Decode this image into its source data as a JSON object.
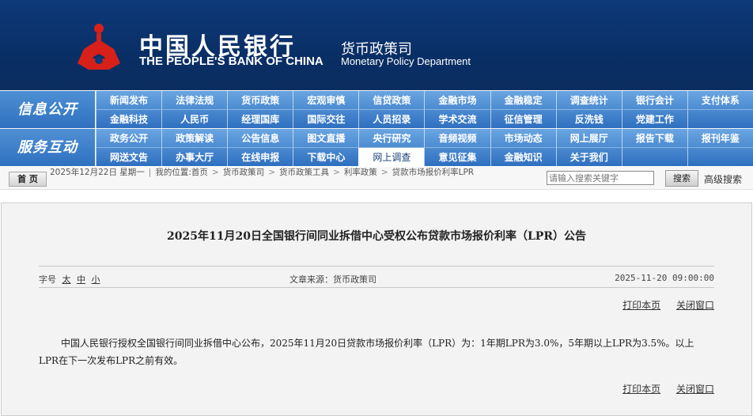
{
  "header": {
    "logo_cn": "中国人民银行",
    "logo_en": "THE PEOPLE'S BANK OF CHINA",
    "dept_cn": "货币政策司",
    "dept_en": "Monetary Policy Department",
    "emblem_color": "#d7201a"
  },
  "nav": {
    "info_label": "信息公开",
    "service_label": "服务互动",
    "info_row1": [
      "新闻发布",
      "法律法规",
      "货币政策",
      "宏观审慎",
      "信贷政策",
      "金融市场",
      "金融稳定",
      "调查统计",
      "银行会计",
      "支付体系"
    ],
    "info_row2": [
      "金融科技",
      "人民币",
      "经理国库",
      "国际交往",
      "人员招录",
      "学术交流",
      "征信管理",
      "反洗钱",
      "党建工作",
      ""
    ],
    "service_row1": [
      "政务公开",
      "政策解读",
      "公告信息",
      "图文直播",
      "央行研究",
      "音频视频",
      "市场动态",
      "网上展厅",
      "报告下载",
      "报刊年鉴"
    ],
    "service_row2": [
      "网送文告",
      "办事大厅",
      "在线申报",
      "下载中心",
      "网上调查",
      "意见征集",
      "金融知识",
      "关于我们",
      "",
      ""
    ],
    "active_item": "网上调查",
    "colors": {
      "band_top": "#6aa6e2",
      "band_bottom": "#2e6fbf",
      "banner": "#0d3a78"
    }
  },
  "breadcrumb": {
    "home_button": "首 页",
    "date": "2025年12月22日 星期一",
    "location_prefix": "我的位置:首页",
    "items": [
      "货币政策司",
      "货币政策工具",
      "利率政策",
      "贷款市场报价利率LPR"
    ],
    "search_placeholder": "请输入搜索关键字",
    "search_button": "搜索",
    "advanced_search": "高级搜索"
  },
  "article": {
    "title": "2025年11月20日全国银行间同业拆借中心受权公布贷款市场报价利率（LPR）公告",
    "font_size_label": "字号",
    "font_size_options": [
      "太",
      "中",
      "小"
    ],
    "source": "文章来源：货币政策司",
    "publish_time": "2025-11-20 09:00:00",
    "print_label": "打印本页",
    "close_label": "关闭窗口",
    "body": "中国人民银行授权全国银行间同业拆借中心公布，2025年11月20日贷款市场报价利率（LPR）为：1年期LPR为3.0%，5年期以上LPR为3.5%。以上LPR在下一次发布LPR之前有效。"
  }
}
